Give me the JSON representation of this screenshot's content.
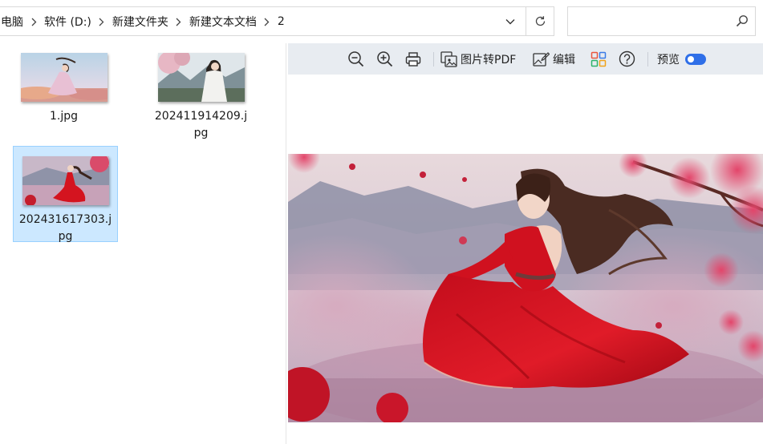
{
  "breadcrumb": {
    "items": [
      "电脑",
      "软件 (D:)",
      "新建文件夹",
      "新建文本文档",
      "2"
    ]
  },
  "search": {
    "placeholder": "",
    "value": ""
  },
  "files": [
    {
      "name": "1.jpg",
      "selected": false,
      "thumb": "dancer-in-pink-dress"
    },
    {
      "name": "202411914209.jpg",
      "selected": false,
      "thumb": "man-in-white-robe"
    },
    {
      "name": "202431617303.jpg",
      "selected": true,
      "thumb": "girl-in-red-dress"
    }
  ],
  "preview": {
    "toolbar": {
      "zoom_out_icon": "zoom-out-icon",
      "zoom_in_icon": "zoom-in-icon",
      "print_icon": "printer-icon",
      "to_pdf_label": "图片转PDF",
      "edit_label": "编辑",
      "apps_icon": "grid-apps-icon",
      "help_icon": "help-icon",
      "preview_label": "预览",
      "preview_toggle_on": true
    },
    "image": "girl-in-red-dress-cherry-blossoms"
  },
  "colors": {
    "selection_bg": "#cce8ff",
    "selection_border": "#99d1ff",
    "toolbar_bg": "#e8ecf1",
    "toggle_on": "#2f6fe8"
  }
}
